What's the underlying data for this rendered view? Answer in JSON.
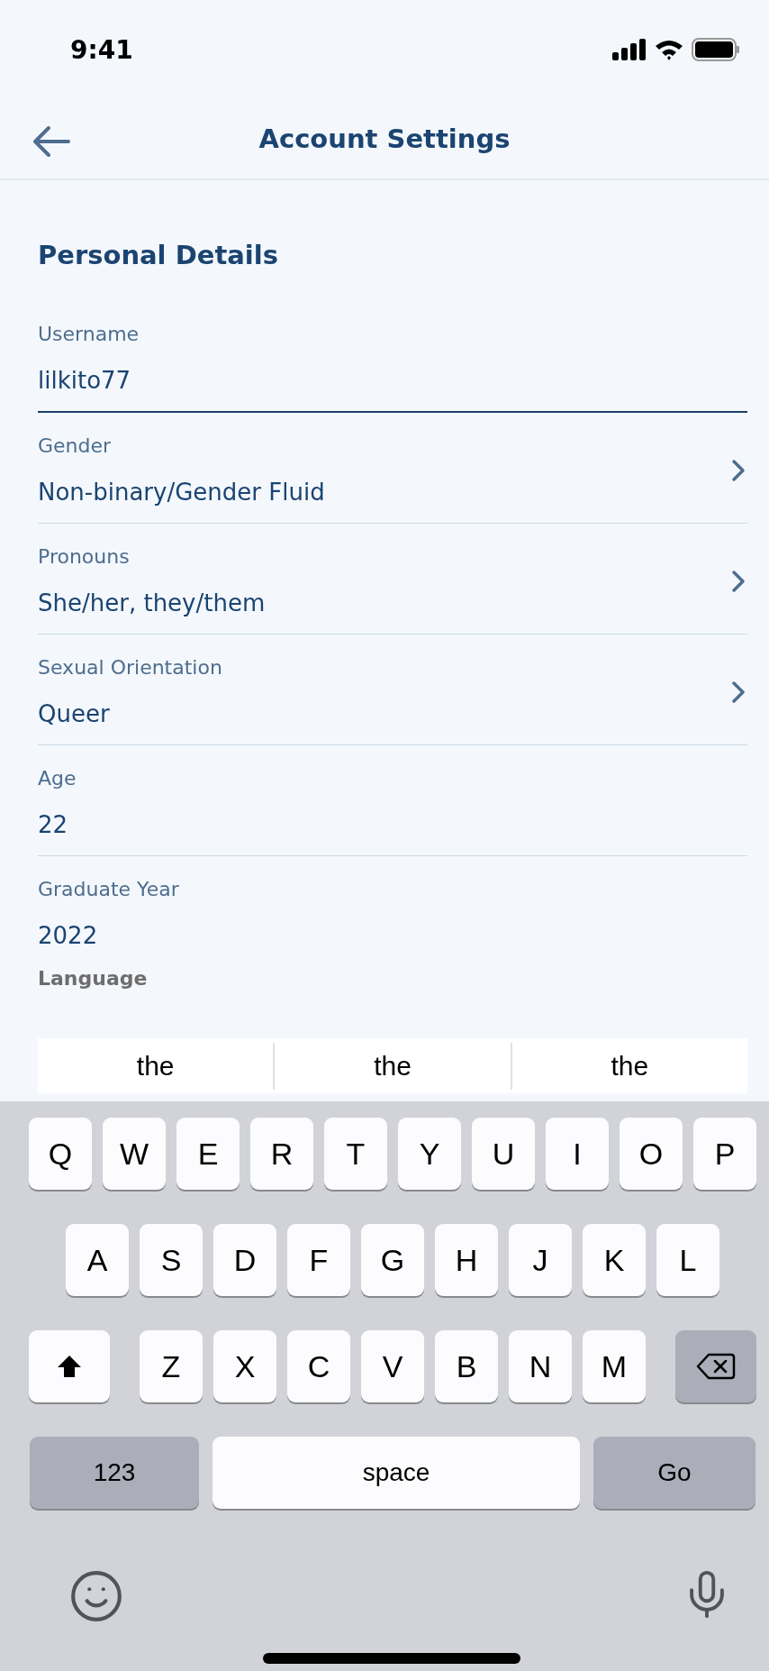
{
  "status_bar": {
    "time": "9:41"
  },
  "nav": {
    "title": "Account Settings"
  },
  "section": {
    "title": "Personal Details"
  },
  "fields": [
    {
      "label": "Username",
      "value": "lilkito77",
      "kind": "text",
      "focused": true
    },
    {
      "label": "Gender",
      "value": "Non-binary/Gender Fluid",
      "kind": "select",
      "focused": false
    },
    {
      "label": "Pronouns",
      "value": "She/her, they/them",
      "kind": "select",
      "focused": false
    },
    {
      "label": "Sexual Orientation",
      "value": "Queer",
      "kind": "select",
      "focused": false
    },
    {
      "label": "Age",
      "value": "22",
      "kind": "text",
      "focused": false
    },
    {
      "label": "Graduate Year",
      "value": "2022",
      "kind": "text",
      "focused": false
    }
  ],
  "partial_field": {
    "label": "Language"
  },
  "suggestions": [
    "the",
    "the",
    "the"
  ],
  "keyboard": {
    "rows": [
      [
        "Q",
        "W",
        "E",
        "R",
        "T",
        "Y",
        "U",
        "I",
        "O",
        "P"
      ],
      [
        "A",
        "S",
        "D",
        "F",
        "G",
        "H",
        "J",
        "K",
        "L"
      ],
      [
        "Z",
        "X",
        "C",
        "V",
        "B",
        "N",
        "M"
      ]
    ],
    "numbers_key": "123",
    "space_key": "space",
    "go_key": "Go"
  }
}
